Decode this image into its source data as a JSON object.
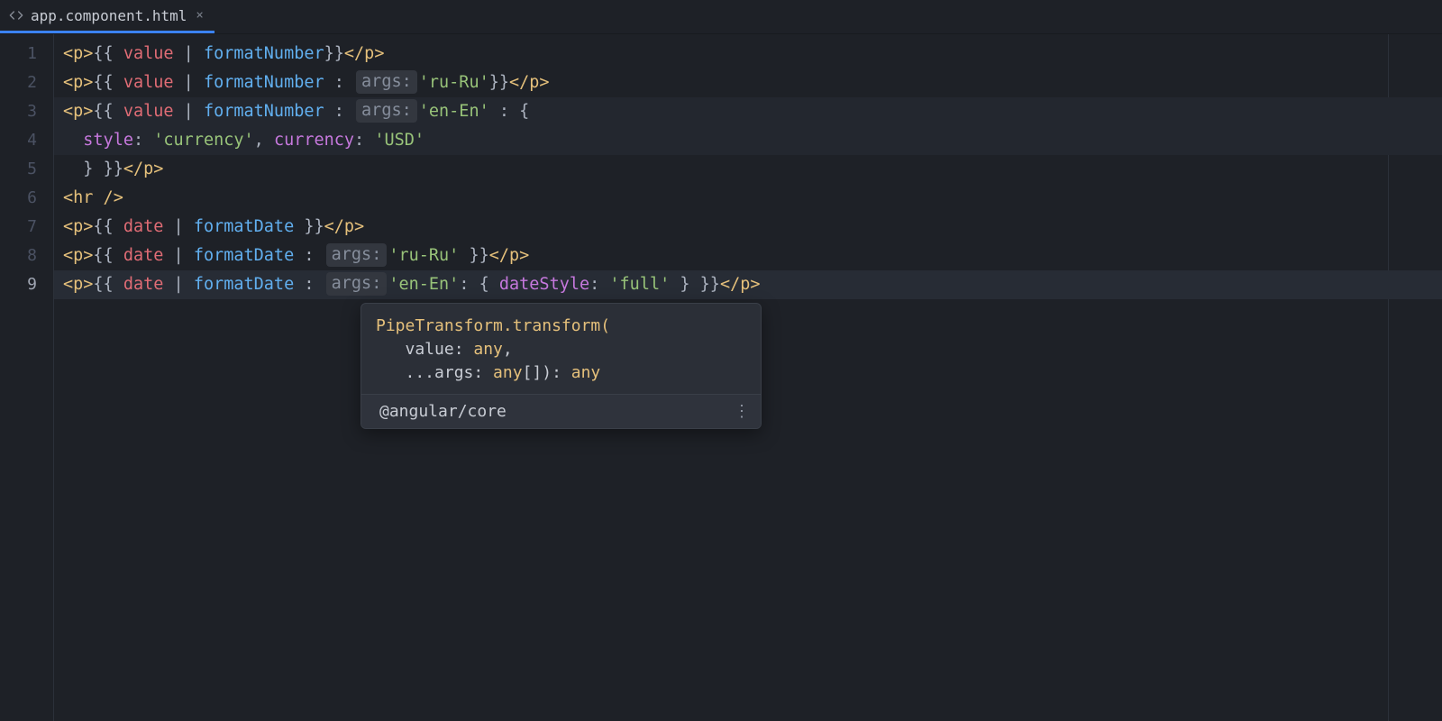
{
  "tab": {
    "filename": "app.component.html",
    "close": "×"
  },
  "hints": {
    "args": "args:"
  },
  "code": {
    "l1": {
      "tag_p_open": "<p>",
      "dopen": "{{ ",
      "var": "value",
      "bar": " | ",
      "pipe": "formatNumber",
      "dclose": "}}",
      "tag_p_close": "</p>"
    },
    "l2": {
      "tag_p_open": "<p>",
      "dopen": "{{ ",
      "var": "value",
      "bar": " | ",
      "pipe": "formatNumber",
      "colon": " : ",
      "str": "'ru-Ru'",
      "dclose": "}}",
      "tag_p_close": "</p>"
    },
    "l3": {
      "tag_p_open": "<p>",
      "dopen": "{{ ",
      "var": "value",
      "bar": " | ",
      "pipe": "formatNumber",
      "colon": " : ",
      "str": "'en-En'",
      "colon2": " : ",
      "brace": "{"
    },
    "l4": {
      "indent": "  ",
      "attr1": "style",
      "c1": ": ",
      "str1": "'currency'",
      "comma": ", ",
      "attr2": "currency",
      "c2": ": ",
      "str2": "'USD'"
    },
    "l5": {
      "indent": "  ",
      "brace": "} ",
      "dclose": "}}",
      "tag_p_close": "</p>"
    },
    "l6": {
      "hr": "<hr />"
    },
    "l7": {
      "tag_p_open": "<p>",
      "dopen": "{{ ",
      "var": "date",
      "bar": " | ",
      "pipe": "formatDate",
      "sp": " ",
      "dclose": "}}",
      "tag_p_close": "</p>"
    },
    "l8": {
      "tag_p_open": "<p>",
      "dopen": "{{ ",
      "var": "date",
      "bar": " | ",
      "pipe": "formatDate",
      "colon": " : ",
      "str": "'ru-Ru'",
      "sp": " ",
      "dclose": "}}",
      "tag_p_close": "</p>"
    },
    "l9": {
      "tag_p_open": "<p>",
      "dopen": "{{ ",
      "var": "date",
      "bar": " | ",
      "pipe": "formatDate",
      "colon": " : ",
      "str": "'en-En'",
      "c2": ": ",
      "brace_o": "{ ",
      "attr": "dateStyle",
      "c3": ": ",
      "str2": "'full'",
      "brace_c": " } ",
      "dclose": "}}",
      "tag_p_close": "</p>"
    }
  },
  "line_numbers": [
    "1",
    "2",
    "3",
    "4",
    "5",
    "6",
    "7",
    "8",
    "9"
  ],
  "popup": {
    "sig1": "PipeTransform.transform(",
    "sig2_a": "   value: ",
    "sig2_b": "any",
    "sig2_c": ",",
    "sig3_a": "   ...args: ",
    "sig3_b": "any",
    "sig3_c": "[]): ",
    "sig3_d": "any",
    "module": "@angular/core",
    "more": "⋮"
  }
}
